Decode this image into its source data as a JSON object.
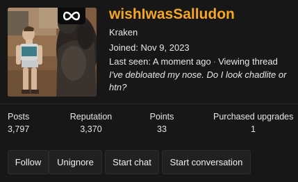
{
  "profile": {
    "username": "wishIwasSalludon",
    "user_title": "Kraken",
    "joined_label": "Joined:",
    "joined_date": "Nov 9, 2023",
    "last_seen_label": "Last seen:",
    "last_seen_value": "A moment ago",
    "activity": "Viewing thread",
    "status": "I've debloated my nose. Do I look chadlite or htn?"
  },
  "stats": {
    "posts": {
      "label": "Posts",
      "value": "3,797"
    },
    "reputation": {
      "label": "Reputation",
      "value": "3,370"
    },
    "points": {
      "label": "Points",
      "value": "33"
    },
    "upgrades": {
      "label": "Purchased upgrades",
      "value": "1"
    }
  },
  "actions": {
    "follow": "Follow",
    "unignore": "Unignore",
    "start_chat": "Start chat",
    "start_conversation": "Start conversation"
  },
  "colors": {
    "username": "#f5a623",
    "background": "#171717",
    "button_bg": "#212121"
  },
  "icons": {
    "avatar_badge": "infinity-icon"
  }
}
